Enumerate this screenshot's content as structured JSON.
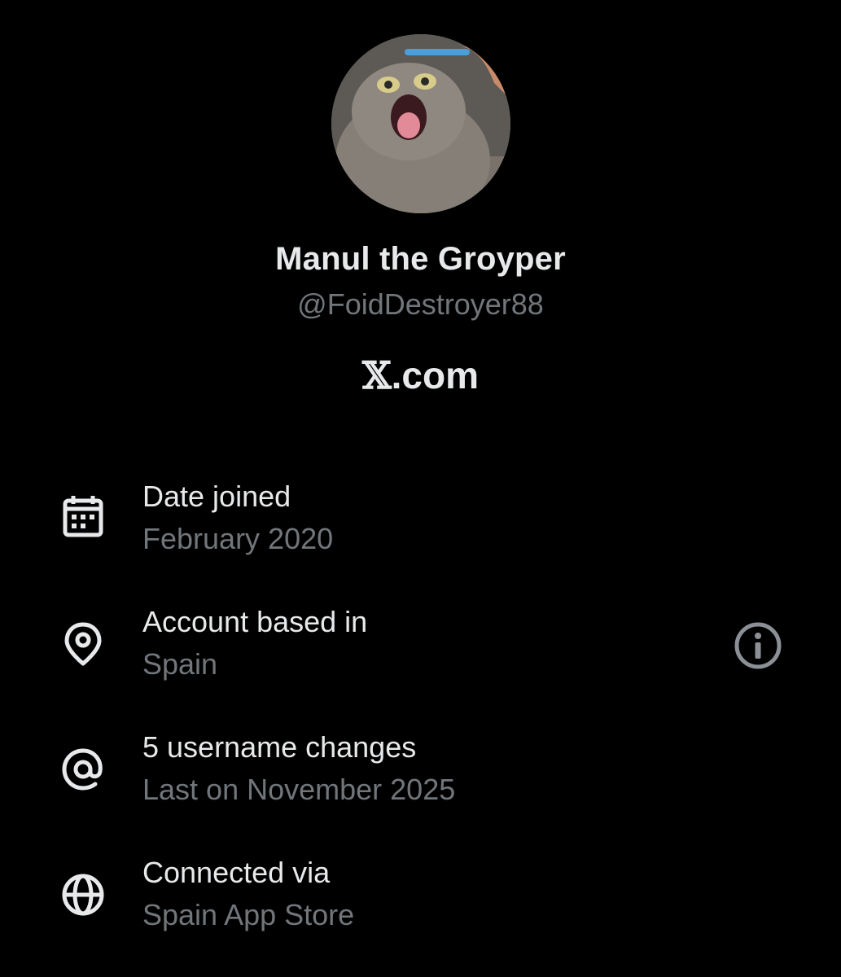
{
  "profile": {
    "display_name": "Manul the Groyper",
    "handle": "@FoidDestroyer88",
    "brand_domain": ".com",
    "brand_mark": "𝕏"
  },
  "about": {
    "rows": [
      {
        "icon": "calendar-icon",
        "title": "Date joined",
        "subtitle": "February 2020"
      },
      {
        "icon": "location-pin-icon",
        "title": "Account based in",
        "subtitle": "Spain"
      },
      {
        "icon": "at-sign-icon",
        "title": "5 username changes",
        "subtitle": "Last on November 2025"
      },
      {
        "icon": "globe-icon",
        "title": "Connected via",
        "subtitle": "Spain App Store"
      }
    ],
    "info_icon": "info-icon"
  },
  "colors": {
    "background": "#000000",
    "primary_text": "#e7e9ea",
    "secondary_text": "#71767b"
  }
}
